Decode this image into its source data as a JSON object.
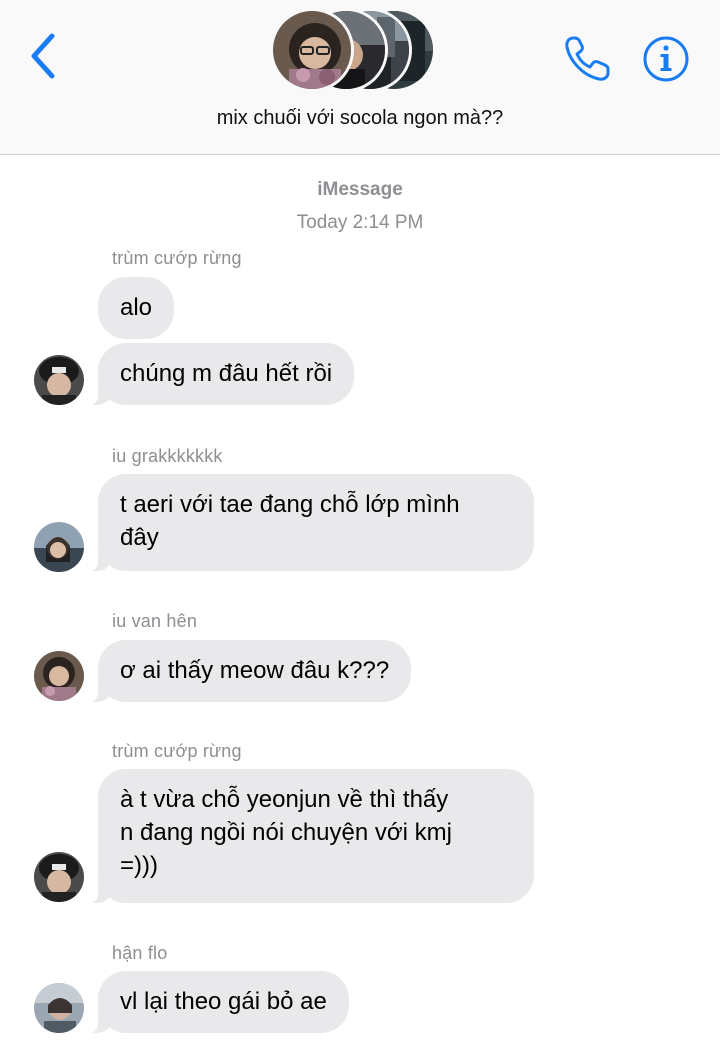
{
  "header": {
    "group_name": "mix chuối với socola ngon mà??",
    "back_icon": "chevron-left-icon",
    "call_icon": "phone-icon",
    "info_icon": "info-icon",
    "accent_color": "#1a7cf2"
  },
  "thread": {
    "service_label": "iMessage",
    "timestamp": "Today 2:14 PM"
  },
  "messages": [
    {
      "sender": "trùm cướp rừng",
      "text": "alo"
    },
    {
      "sender": "",
      "text": "chúng m đâu hết rồi"
    },
    {
      "sender": "iu grakkkkkkk",
      "text": "t aeri với tae đang chỗ lớp mình\nđây"
    },
    {
      "sender": "iu van hên",
      "text": "ơ ai thấy meow đâu k???"
    },
    {
      "sender": "trùm cướp rừng",
      "text": "à t vừa chỗ yeonjun về thì thấy\nn đang ngồi nói chuyện với kmj\n=)))"
    },
    {
      "sender": "hận flo",
      "text": "vl lại theo gái bỏ ae"
    }
  ],
  "colors": {
    "bubble_received": "#e9e9eb",
    "meta_text": "#8e8e93"
  }
}
